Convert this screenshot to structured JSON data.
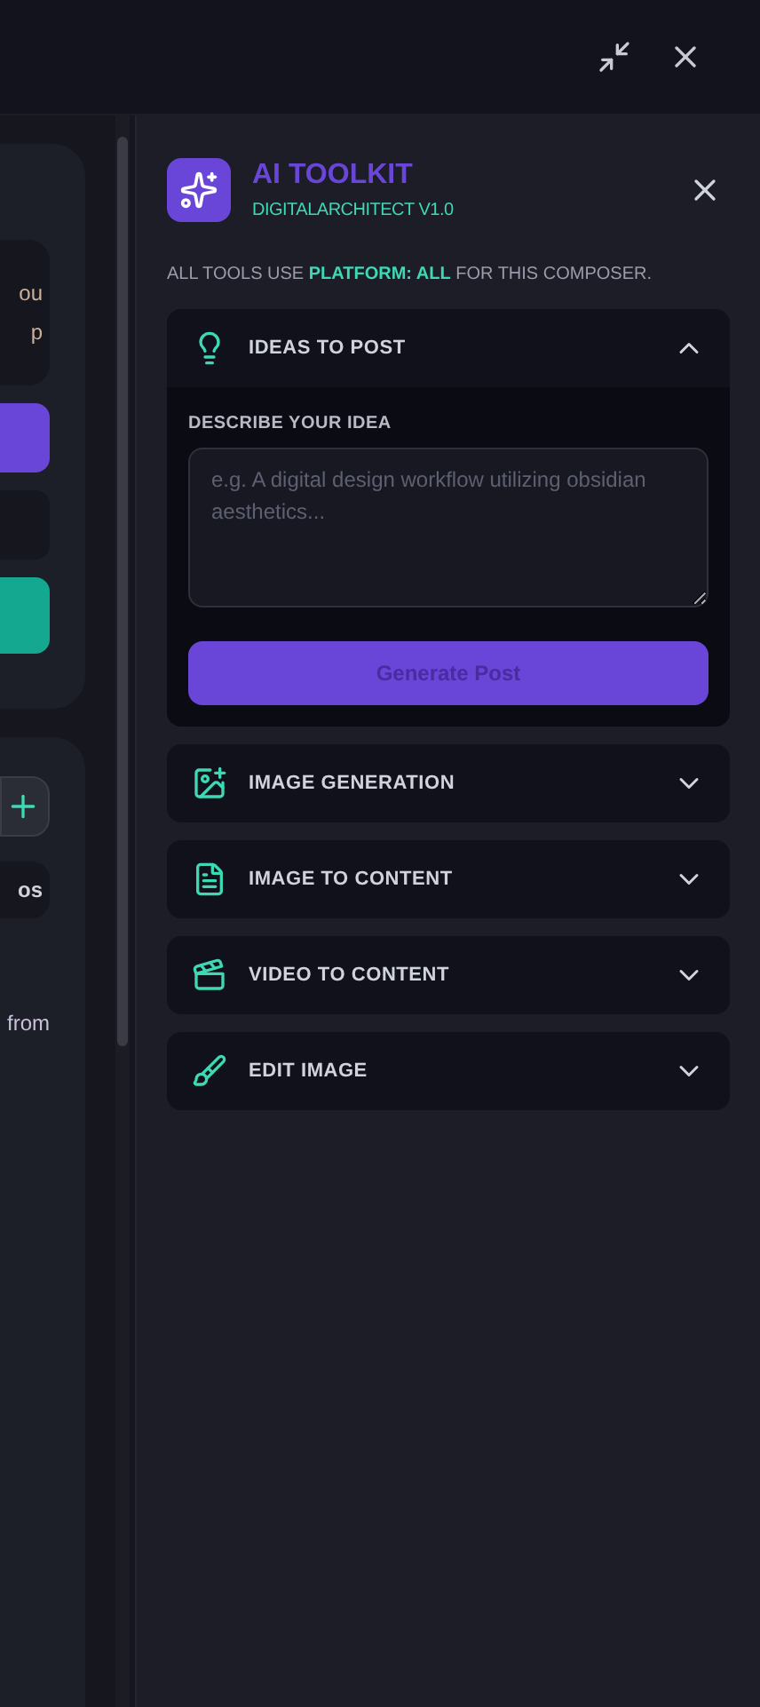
{
  "background": {
    "card_texts": [
      "ou",
      "p"
    ],
    "pill_text": "os",
    "snippet": "from"
  },
  "toolkit": {
    "title": "AI TOOLKIT",
    "subtitle": "DIGITALARCHITECT V1.0",
    "note": "ALL TOOLS USE **PLATFORM: ALL** FOR THIS COMPOSER.",
    "sections": [
      {
        "label": "IDEAS TO POST",
        "expanded": true,
        "field_label": "DESCRIBE YOUR IDEA",
        "placeholder": "e.g. A digital design workflow utilizing obsidian aesthetics...",
        "button": "Generate Post"
      },
      {
        "label": "IMAGE GENERATION",
        "expanded": false
      },
      {
        "label": "IMAGE TO CONTENT",
        "expanded": false
      },
      {
        "label": "VIDEO TO CONTENT",
        "expanded": false
      },
      {
        "label": "EDIT IMAGE",
        "expanded": false
      }
    ]
  }
}
